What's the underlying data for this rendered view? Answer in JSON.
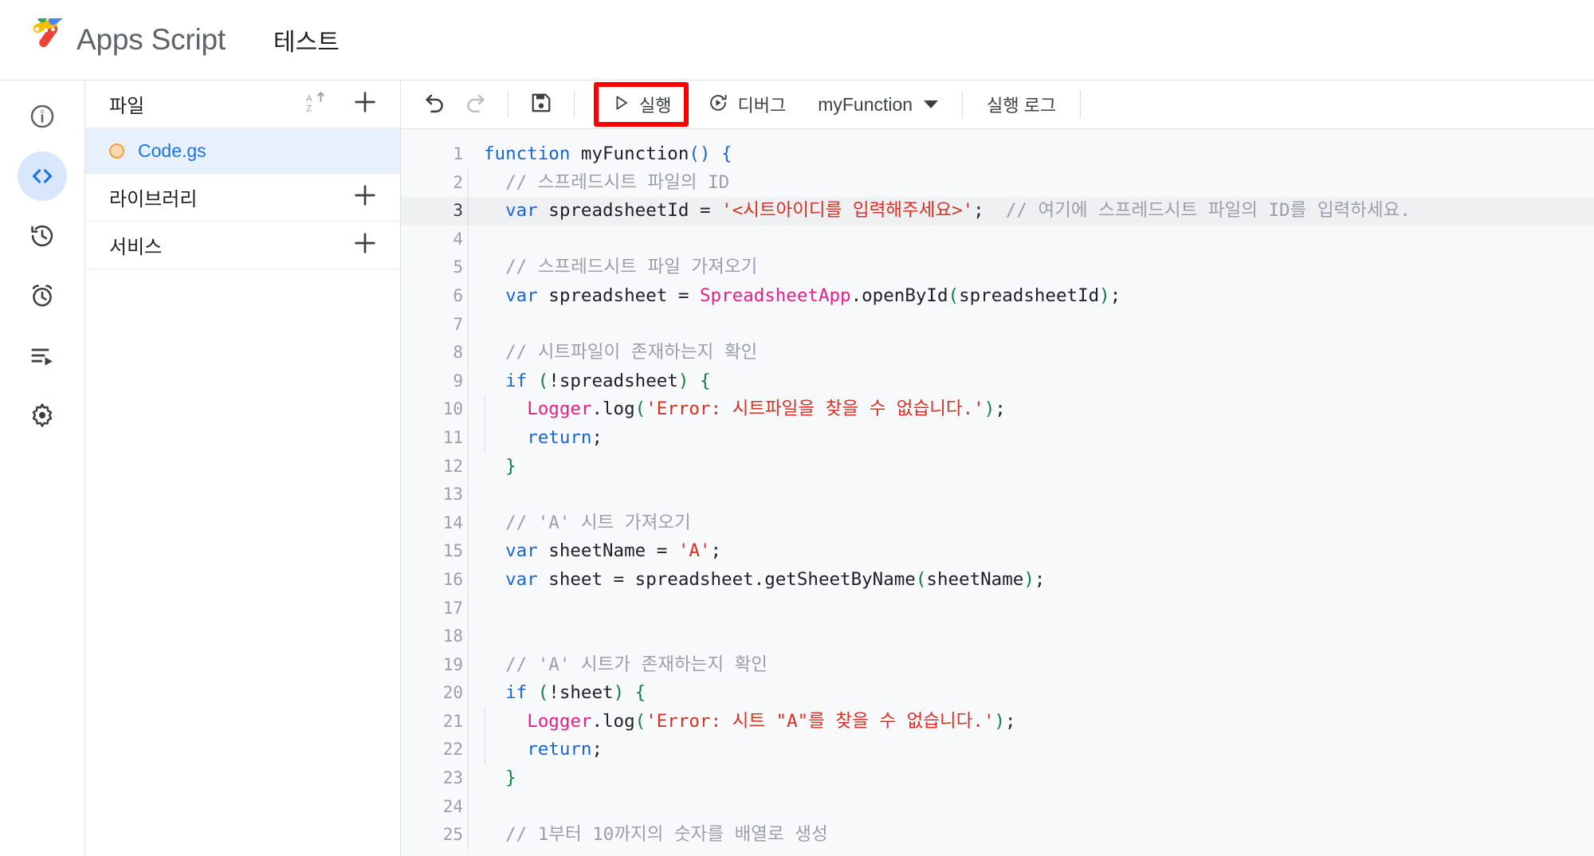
{
  "header": {
    "logo_name": "apps-script-logo",
    "brand": "Apps Script",
    "project_title": "테스트"
  },
  "rail": {
    "items": [
      {
        "name": "overview",
        "icon": "info-circle-icon",
        "active": false
      },
      {
        "name": "editor",
        "icon": "code-brackets-icon",
        "active": true
      },
      {
        "name": "versions",
        "icon": "history-clock-icon",
        "active": false
      },
      {
        "name": "triggers",
        "icon": "alarm-clock-icon",
        "active": false
      },
      {
        "name": "executions",
        "icon": "execution-list-icon",
        "active": false
      },
      {
        "name": "settings",
        "icon": "gear-icon",
        "active": false
      }
    ]
  },
  "file_panel": {
    "files_header": "파일",
    "sort_icon": "sort-az-icon",
    "add_file_icon": "plus-icon",
    "files": [
      {
        "name": "Code.gs",
        "selected": true,
        "dot_color": "#f2a03d"
      }
    ],
    "libraries_header": "라이브러리",
    "libraries_add_icon": "plus-icon",
    "services_header": "서비스",
    "services_add_icon": "plus-icon"
  },
  "toolbar": {
    "undo_icon": "undo-icon",
    "redo_icon": "redo-icon",
    "save_icon": "save-floppy-icon",
    "run_label": "실행",
    "run_icon": "play-triangle-icon",
    "debug_label": "디버그",
    "debug_icon": "debug-step-icon",
    "function_name": "myFunction",
    "function_caret_icon": "caret-down-icon",
    "execution_log_label": "실행 로그",
    "highlight_color": "#ff0000",
    "highlighted_element": "run-button"
  },
  "editor": {
    "active_line": 3,
    "colors": {
      "keyword": "#1967d2",
      "class": "#e91e8c",
      "string": "#d93025",
      "comment": "#9aa0a6",
      "plain": "#202124",
      "paren": "#0a8043",
      "background": "#f8f9fa",
      "active_line_bg": "#eef0f2"
    },
    "lines": [
      {
        "n": 1,
        "indent": 0,
        "tokens": [
          {
            "t": "kw",
            "v": "function"
          },
          {
            "t": "plain",
            "v": " "
          },
          {
            "t": "fn",
            "v": "myFunction"
          },
          {
            "t": "brk",
            "v": "()"
          },
          {
            "t": "plain",
            "v": " "
          },
          {
            "t": "brk",
            "v": "{"
          }
        ]
      },
      {
        "n": 2,
        "indent": 1,
        "tokens": [
          {
            "t": "com",
            "v": "// 스프레드시트 파일의 ID"
          }
        ]
      },
      {
        "n": 3,
        "indent": 1,
        "tokens": [
          {
            "t": "kw",
            "v": "var"
          },
          {
            "t": "plain",
            "v": " spreadsheetId "
          },
          {
            "t": "op",
            "v": "="
          },
          {
            "t": "plain",
            "v": " "
          },
          {
            "t": "str",
            "v": "'<시트아이디를 입력해주세요>'"
          },
          {
            "t": "plain",
            "v": ";"
          },
          {
            "t": "plain",
            "v": "  "
          },
          {
            "t": "com",
            "v": "// 여기에 스프레드시트 파일의 ID를 입력하세요."
          }
        ]
      },
      {
        "n": 4,
        "indent": 1,
        "tokens": []
      },
      {
        "n": 5,
        "indent": 1,
        "tokens": [
          {
            "t": "com",
            "v": "// 스프레드시트 파일 가져오기"
          }
        ]
      },
      {
        "n": 6,
        "indent": 1,
        "tokens": [
          {
            "t": "kw",
            "v": "var"
          },
          {
            "t": "plain",
            "v": " spreadsheet "
          },
          {
            "t": "op",
            "v": "="
          },
          {
            "t": "plain",
            "v": " "
          },
          {
            "t": "cls",
            "v": "SpreadsheetApp"
          },
          {
            "t": "plain",
            "v": ".openById"
          },
          {
            "t": "paren",
            "v": "("
          },
          {
            "t": "plain",
            "v": "spreadsheetId"
          },
          {
            "t": "paren",
            "v": ")"
          },
          {
            "t": "plain",
            "v": ";"
          }
        ]
      },
      {
        "n": 7,
        "indent": 1,
        "tokens": []
      },
      {
        "n": 8,
        "indent": 1,
        "tokens": [
          {
            "t": "com",
            "v": "// 시트파일이 존재하는지 확인"
          }
        ]
      },
      {
        "n": 9,
        "indent": 1,
        "tokens": [
          {
            "t": "kw",
            "v": "if"
          },
          {
            "t": "plain",
            "v": " "
          },
          {
            "t": "paren",
            "v": "("
          },
          {
            "t": "plain",
            "v": "!spreadsheet"
          },
          {
            "t": "paren",
            "v": ")"
          },
          {
            "t": "plain",
            "v": " "
          },
          {
            "t": "brace",
            "v": "{"
          }
        ]
      },
      {
        "n": 10,
        "indent": 2,
        "tokens": [
          {
            "t": "cls",
            "v": "Logger"
          },
          {
            "t": "plain",
            "v": ".log"
          },
          {
            "t": "paren",
            "v": "("
          },
          {
            "t": "str",
            "v": "'Error: 시트파일을 찾을 수 없습니다.'"
          },
          {
            "t": "paren",
            "v": ")"
          },
          {
            "t": "plain",
            "v": ";"
          }
        ]
      },
      {
        "n": 11,
        "indent": 2,
        "tokens": [
          {
            "t": "kw",
            "v": "return"
          },
          {
            "t": "plain",
            "v": ";"
          }
        ]
      },
      {
        "n": 12,
        "indent": 1,
        "tokens": [
          {
            "t": "brace",
            "v": "}"
          }
        ]
      },
      {
        "n": 13,
        "indent": 1,
        "tokens": []
      },
      {
        "n": 14,
        "indent": 1,
        "tokens": [
          {
            "t": "com",
            "v": "// 'A' 시트 가져오기"
          }
        ]
      },
      {
        "n": 15,
        "indent": 1,
        "tokens": [
          {
            "t": "kw",
            "v": "var"
          },
          {
            "t": "plain",
            "v": " sheetName "
          },
          {
            "t": "op",
            "v": "="
          },
          {
            "t": "plain",
            "v": " "
          },
          {
            "t": "str",
            "v": "'A'"
          },
          {
            "t": "plain",
            "v": ";"
          }
        ]
      },
      {
        "n": 16,
        "indent": 1,
        "tokens": [
          {
            "t": "kw",
            "v": "var"
          },
          {
            "t": "plain",
            "v": " sheet "
          },
          {
            "t": "op",
            "v": "="
          },
          {
            "t": "plain",
            "v": " spreadsheet.getSheetByName"
          },
          {
            "t": "paren",
            "v": "("
          },
          {
            "t": "plain",
            "v": "sheetName"
          },
          {
            "t": "paren",
            "v": ")"
          },
          {
            "t": "plain",
            "v": ";"
          }
        ]
      },
      {
        "n": 17,
        "indent": 1,
        "tokens": []
      },
      {
        "n": 18,
        "indent": 1,
        "tokens": []
      },
      {
        "n": 19,
        "indent": 1,
        "tokens": [
          {
            "t": "com",
            "v": "// 'A' 시트가 존재하는지 확인"
          }
        ]
      },
      {
        "n": 20,
        "indent": 1,
        "tokens": [
          {
            "t": "kw",
            "v": "if"
          },
          {
            "t": "plain",
            "v": " "
          },
          {
            "t": "paren",
            "v": "("
          },
          {
            "t": "plain",
            "v": "!sheet"
          },
          {
            "t": "paren",
            "v": ")"
          },
          {
            "t": "plain",
            "v": " "
          },
          {
            "t": "brace",
            "v": "{"
          }
        ]
      },
      {
        "n": 21,
        "indent": 2,
        "tokens": [
          {
            "t": "cls",
            "v": "Logger"
          },
          {
            "t": "plain",
            "v": ".log"
          },
          {
            "t": "paren",
            "v": "("
          },
          {
            "t": "str",
            "v": "'Error: 시트 \"A\"를 찾을 수 없습니다.'"
          },
          {
            "t": "paren",
            "v": ")"
          },
          {
            "t": "plain",
            "v": ";"
          }
        ]
      },
      {
        "n": 22,
        "indent": 2,
        "tokens": [
          {
            "t": "kw",
            "v": "return"
          },
          {
            "t": "plain",
            "v": ";"
          }
        ]
      },
      {
        "n": 23,
        "indent": 1,
        "tokens": [
          {
            "t": "brace",
            "v": "}"
          }
        ]
      },
      {
        "n": 24,
        "indent": 1,
        "tokens": []
      },
      {
        "n": 25,
        "indent": 1,
        "tokens": [
          {
            "t": "com",
            "v": "// 1부터 10까지의 숫자를 배열로 생성"
          }
        ]
      }
    ]
  }
}
